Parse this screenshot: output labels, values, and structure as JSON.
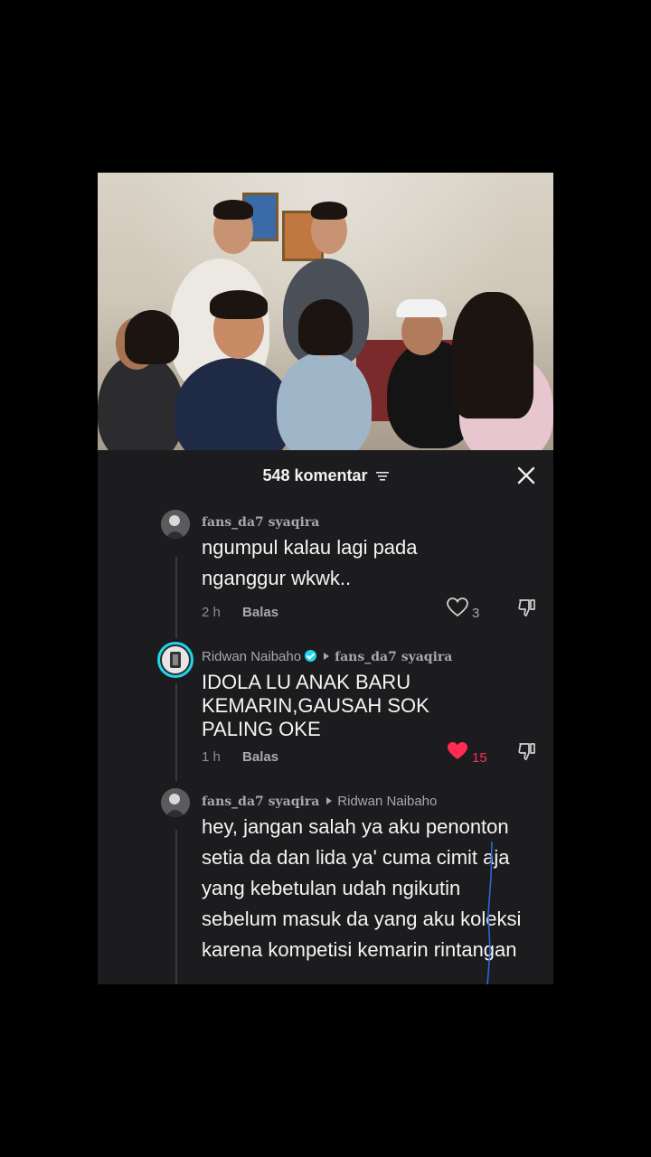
{
  "header": {
    "comment_count": "548 komentar",
    "filter_icon": "filter-icon",
    "close_icon": "close-icon"
  },
  "comments": [
    {
      "username": "fans_da7 syaqira",
      "text": "ngumpul kalau lagi pada nganggur wkwk..",
      "time": "2 h",
      "reply_label": "Balas",
      "likes": "3",
      "liked": false
    },
    {
      "username": "Ridwan Naibaho",
      "verified": true,
      "reply_to": "fans_da7 syaqira",
      "text": "IDOLA LU ANAK BARU KEMARIN,GAUSAH SOK PALING OKE",
      "time": "1 h",
      "reply_label": "Balas",
      "likes": "15",
      "liked": true,
      "like_color": "#fe2c55"
    },
    {
      "username": "fans_da7 syaqira",
      "reply_to": "Ridwan Naibaho",
      "text": "hey, jangan salah ya aku penonton setia da dan lida ya' cuma cimit aja yang kebetulan udah ngikutin sebelum masuk da yang aku koleksi karena kompetisi kemarin rintangan"
    }
  ],
  "colors": {
    "sheet_bg": "#1c1c1e",
    "accent_verified": "#20d5ec",
    "like_red": "#fe2c55"
  }
}
